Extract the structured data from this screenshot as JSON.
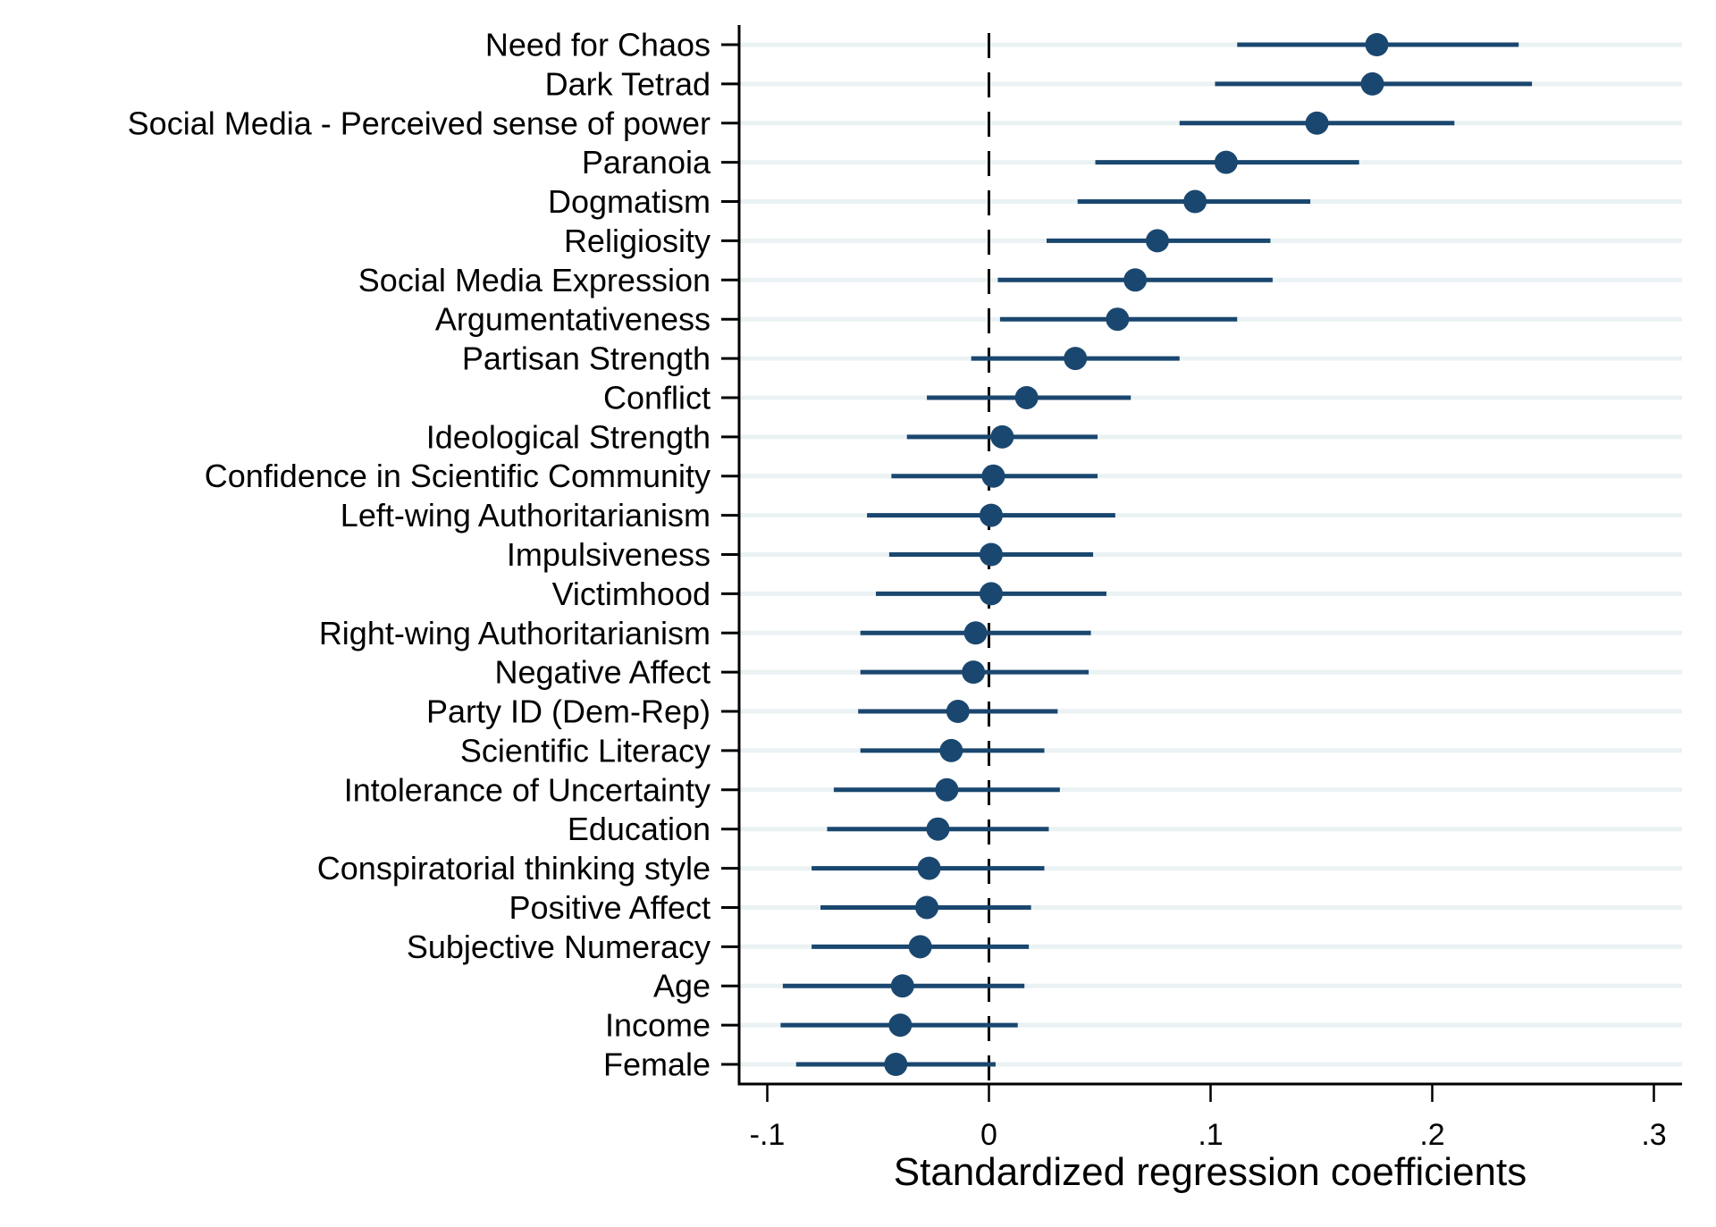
{
  "chart_data": {
    "type": "scatter",
    "subtype": "coefficient-plot",
    "title": "",
    "xlabel": "Standardized regression coefficients",
    "ylabel": "",
    "xlim": [
      -0.113,
      0.312
    ],
    "xticks": [
      -0.1,
      0,
      0.1,
      0.2,
      0.3
    ],
    "xtick_labels": [
      "-.1",
      "0",
      ".1",
      ".2",
      ".3"
    ],
    "reference_line": {
      "x": 0,
      "style": "dashed"
    },
    "grid": "horizontal",
    "legend": "none",
    "colors": {
      "marker": "#1a476f",
      "ci": "#1a476f",
      "grid": "#eaf2f3",
      "axis": "#000000"
    },
    "series": [
      {
        "name": "Standardized regression coefficients",
        "points": [
          {
            "label": "Need for Chaos",
            "estimate": 0.175,
            "ci_low": 0.112,
            "ci_high": 0.239
          },
          {
            "label": "Dark Tetrad",
            "estimate": 0.173,
            "ci_low": 0.102,
            "ci_high": 0.245
          },
          {
            "label": "Social Media - Perceived sense of power",
            "estimate": 0.148,
            "ci_low": 0.086,
            "ci_high": 0.21
          },
          {
            "label": "Paranoia",
            "estimate": 0.107,
            "ci_low": 0.048,
            "ci_high": 0.167
          },
          {
            "label": "Dogmatism",
            "estimate": 0.093,
            "ci_low": 0.04,
            "ci_high": 0.145
          },
          {
            "label": "Religiosity",
            "estimate": 0.076,
            "ci_low": 0.026,
            "ci_high": 0.127
          },
          {
            "label": "Social Media Expression",
            "estimate": 0.066,
            "ci_low": 0.004,
            "ci_high": 0.128
          },
          {
            "label": "Argumentativeness",
            "estimate": 0.058,
            "ci_low": 0.005,
            "ci_high": 0.112
          },
          {
            "label": "Partisan Strength",
            "estimate": 0.039,
            "ci_low": -0.008,
            "ci_high": 0.086
          },
          {
            "label": "Conflict",
            "estimate": 0.017,
            "ci_low": -0.028,
            "ci_high": 0.064
          },
          {
            "label": "Ideological Strength",
            "estimate": 0.006,
            "ci_low": -0.037,
            "ci_high": 0.049
          },
          {
            "label": "Confidence in Scientific Community",
            "estimate": 0.002,
            "ci_low": -0.044,
            "ci_high": 0.049
          },
          {
            "label": "Left-wing Authoritarianism",
            "estimate": 0.001,
            "ci_low": -0.055,
            "ci_high": 0.057
          },
          {
            "label": "Impulsiveness",
            "estimate": 0.001,
            "ci_low": -0.045,
            "ci_high": 0.047
          },
          {
            "label": "Victimhood",
            "estimate": 0.001,
            "ci_low": -0.051,
            "ci_high": 0.053
          },
          {
            "label": "Right-wing Authoritarianism",
            "estimate": -0.006,
            "ci_low": -0.058,
            "ci_high": 0.046
          },
          {
            "label": "Negative Affect",
            "estimate": -0.007,
            "ci_low": -0.058,
            "ci_high": 0.045
          },
          {
            "label": "Party ID (Dem-Rep)",
            "estimate": -0.014,
            "ci_low": -0.059,
            "ci_high": 0.031
          },
          {
            "label": "Scientific Literacy",
            "estimate": -0.017,
            "ci_low": -0.058,
            "ci_high": 0.025
          },
          {
            "label": "Intolerance of Uncertainty",
            "estimate": -0.019,
            "ci_low": -0.07,
            "ci_high": 0.032
          },
          {
            "label": "Education",
            "estimate": -0.023,
            "ci_low": -0.073,
            "ci_high": 0.027
          },
          {
            "label": "Conspiratorial thinking style",
            "estimate": -0.027,
            "ci_low": -0.08,
            "ci_high": 0.025
          },
          {
            "label": "Positive Affect",
            "estimate": -0.028,
            "ci_low": -0.076,
            "ci_high": 0.019
          },
          {
            "label": "Subjective Numeracy",
            "estimate": -0.031,
            "ci_low": -0.08,
            "ci_high": 0.018
          },
          {
            "label": "Age",
            "estimate": -0.039,
            "ci_low": -0.093,
            "ci_high": 0.016
          },
          {
            "label": "Income",
            "estimate": -0.04,
            "ci_low": -0.094,
            "ci_high": 0.013
          },
          {
            "label": "Female",
            "estimate": -0.042,
            "ci_low": -0.087,
            "ci_high": 0.003
          }
        ]
      }
    ]
  }
}
